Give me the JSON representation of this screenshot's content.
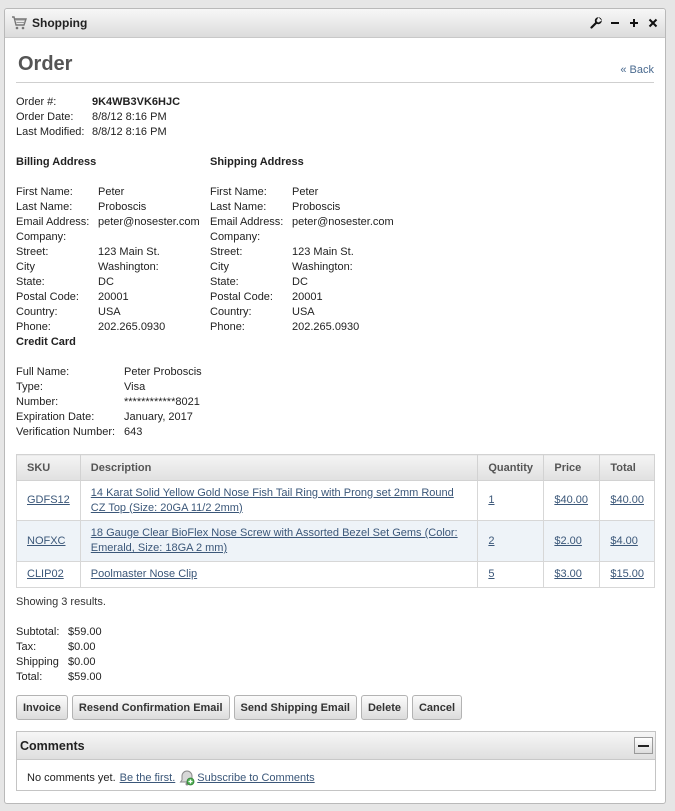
{
  "window": {
    "title": "Shopping",
    "controls": [
      "wrench-icon",
      "minimize-icon",
      "maximize-icon",
      "close-icon"
    ]
  },
  "order": {
    "heading": "Order",
    "back_label": "« Back",
    "number_label": "Order #:",
    "number": "9K4WB3VK6HJC",
    "date_label": "Order Date:",
    "date": "8/8/12 8:16 PM",
    "modified_label": "Last Modified:",
    "modified": "8/8/12 8:16 PM"
  },
  "billing": {
    "title": "Billing Address",
    "rows": [
      {
        "k": "First Name:",
        "v": "Peter"
      },
      {
        "k": "Last Name:",
        "v": "Proboscis"
      },
      {
        "k": "Email Address:",
        "v": "peter@nosester.com"
      },
      {
        "k": "Company:",
        "v": ""
      },
      {
        "k": "Street:",
        "v": "123 Main St."
      },
      {
        "k": "City",
        "v": "Washington:"
      },
      {
        "k": "State:",
        "v": "DC"
      },
      {
        "k": "Postal Code:",
        "v": "20001"
      },
      {
        "k": "Country:",
        "v": "USA"
      },
      {
        "k": "Phone:",
        "v": "202.265.0930"
      }
    ]
  },
  "shipping": {
    "title": "Shipping Address",
    "rows": [
      {
        "k": "First Name:",
        "v": "Peter"
      },
      {
        "k": "Last Name:",
        "v": "Proboscis"
      },
      {
        "k": "Email Address:",
        "v": "peter@nosester.com"
      },
      {
        "k": "Company:",
        "v": ""
      },
      {
        "k": "Street:",
        "v": "123 Main St."
      },
      {
        "k": "City",
        "v": "Washington:"
      },
      {
        "k": "State:",
        "v": "DC"
      },
      {
        "k": "Postal Code:",
        "v": "20001"
      },
      {
        "k": "Country:",
        "v": "USA"
      },
      {
        "k": "Phone:",
        "v": "202.265.0930"
      }
    ]
  },
  "credit_card": {
    "title": "Credit Card",
    "rows": [
      {
        "k": "Full Name:",
        "v": "Peter Proboscis"
      },
      {
        "k": "Type:",
        "v": "Visa"
      },
      {
        "k": "Number:",
        "v": "************8021"
      },
      {
        "k": "Expiration Date:",
        "v": "January, 2017"
      },
      {
        "k": "Verification Number:",
        "v": "643"
      }
    ]
  },
  "items": {
    "columns": [
      "SKU",
      "Description",
      "Quantity",
      "Price",
      "Total"
    ],
    "rows": [
      {
        "sku": "GDFS12",
        "description": "14 Karat Solid Yellow Gold Nose Fish Tail Ring with Prong set 2mm Round CZ Top (Size: 20GA 11/2 2mm)",
        "quantity": "1",
        "price": "$40.00",
        "total": "$40.00"
      },
      {
        "sku": "NOFXC",
        "description": "18 Gauge Clear BioFlex Nose Screw with Assorted Bezel Set Gems (Color: Emerald, Size: 18GA 2 mm)",
        "quantity": "2",
        "price": "$2.00",
        "total": "$4.00"
      },
      {
        "sku": "CLIP02",
        "description": "Poolmaster Nose Clip",
        "quantity": "5",
        "price": "$3.00",
        "total": "$15.00"
      }
    ],
    "showing": "Showing 3 results."
  },
  "totals": {
    "rows": [
      {
        "k": "Subtotal:",
        "v": "$59.00"
      },
      {
        "k": "Tax:",
        "v": "$0.00"
      },
      {
        "k": "Shipping",
        "v": "$0.00"
      },
      {
        "k": "Total:",
        "v": "$59.00"
      }
    ]
  },
  "buttons": {
    "invoice": "Invoice",
    "resend": "Resend Confirmation Email",
    "send_shipping": "Send Shipping Email",
    "delete": "Delete",
    "cancel": "Cancel"
  },
  "comments": {
    "title": "Comments",
    "empty_text": "No comments yet.",
    "be_first": "Be the first.",
    "subscribe": "Subscribe to Comments"
  }
}
